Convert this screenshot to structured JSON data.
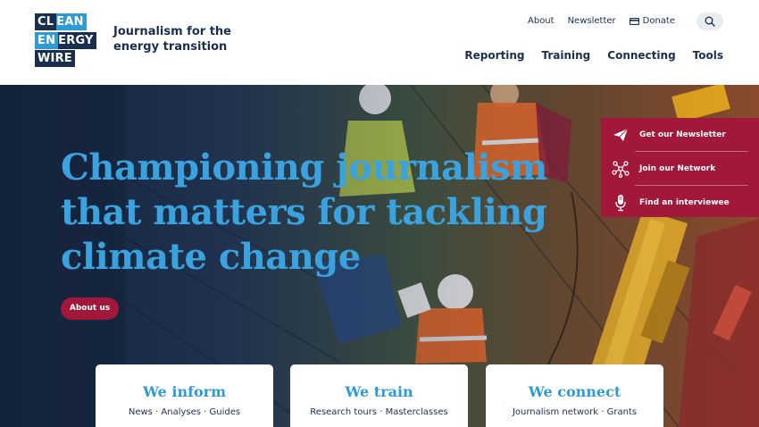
{
  "logo": {
    "row1": [
      "CL",
      "EAN"
    ],
    "row2": [
      "EN",
      "ERGY"
    ],
    "row3": [
      "WIRE"
    ]
  },
  "tagline": "Journalism for the energy transition",
  "utility_nav": {
    "about": "About",
    "newsletter": "Newsletter",
    "donate": "Donate",
    "search_icon": "search-icon",
    "donate_icon": "wallet-icon"
  },
  "main_nav": [
    "Reporting",
    "Training",
    "Connecting",
    "Tools"
  ],
  "hero": {
    "title": "Championing journalism that matters for tackling climate change",
    "about_button": "About us"
  },
  "side_panel": [
    {
      "label": "Get our Newsletter",
      "icon": "paper-plane-icon"
    },
    {
      "label": "Join our Network",
      "icon": "network-icon"
    },
    {
      "label": "Find an interviewee",
      "icon": "microphone-icon"
    }
  ],
  "cards": [
    {
      "title": "We inform",
      "subtitle": "News · Analyses · Guides"
    },
    {
      "title": "We train",
      "subtitle": "Research tours · Masterclasses"
    },
    {
      "title": "We connect",
      "subtitle": "Journalism network · Grants"
    }
  ],
  "colors": {
    "navy": "#1a2f4f",
    "brand_blue": "#2d9bd5",
    "hero_title": "#3aa3df",
    "crimson": "#a2183a"
  }
}
